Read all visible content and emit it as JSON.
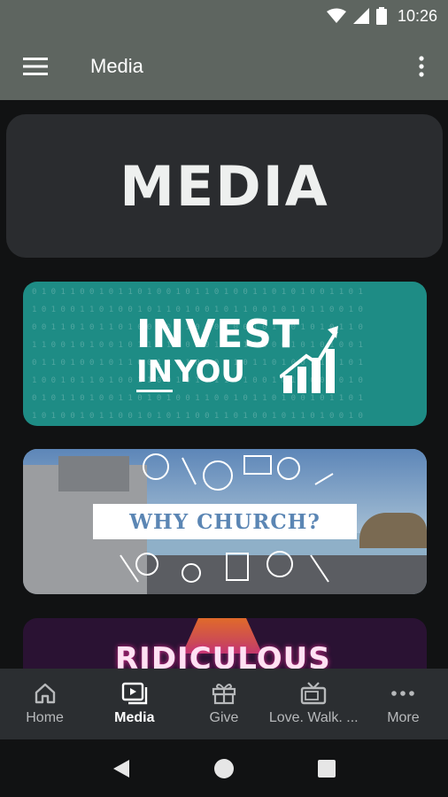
{
  "status_bar": {
    "time": "10:26"
  },
  "app_bar": {
    "title": "Media"
  },
  "header_card": {
    "title": "MEDIA"
  },
  "cards": [
    {
      "title_line1": "INVEST",
      "title_line2_prefix": "IN",
      "title_line2_suffix": "YOU"
    },
    {
      "title": "WHY CHURCH?"
    },
    {
      "title": "RIDICULOUS"
    }
  ],
  "bottom_nav": {
    "items": [
      {
        "label": "Home",
        "icon": "home-icon"
      },
      {
        "label": "Media",
        "icon": "media-icon"
      },
      {
        "label": "Give",
        "icon": "gift-icon"
      },
      {
        "label": "Love. Walk. ...",
        "icon": "tv-icon"
      },
      {
        "label": "More",
        "icon": "more-horizontal-icon"
      }
    ],
    "active_index": 1
  },
  "colors": {
    "app_bar": "#5e6560",
    "background": "#111213",
    "nav_bar": "#2b2e31",
    "invest_card": "#1e8c85",
    "why_label_text": "#5b86b4"
  }
}
